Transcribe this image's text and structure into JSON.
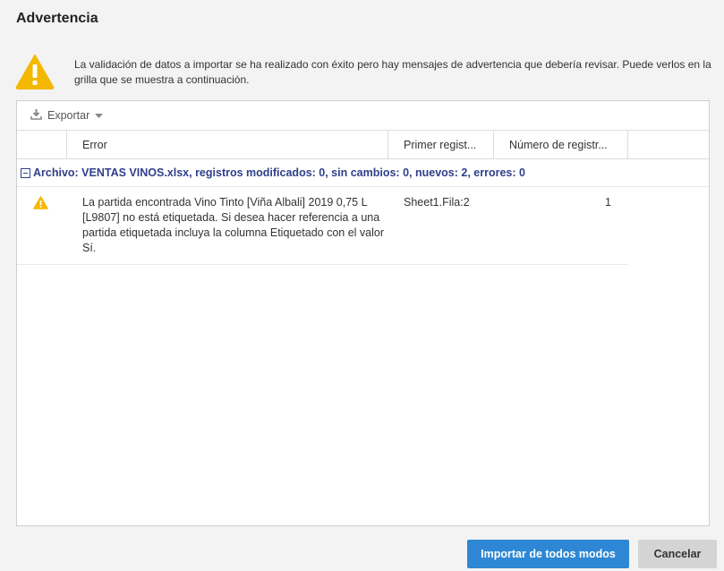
{
  "dialog": {
    "title": "Advertencia",
    "message": "La validación de datos a importar se ha realizado con éxito pero hay mensajes de advertencia que debería revisar. Puede verlos en la grilla que se muestra a continuación.",
    "warning_color": "#f5b800"
  },
  "toolbar": {
    "export_label": "Exportar",
    "export_icon": "download-icon",
    "dropdown_icon": "caret-down-icon"
  },
  "grid": {
    "columns": [
      "",
      "Error",
      "Primer regist...",
      "Número de registr..."
    ],
    "group_label": "Archivo: VENTAS VINOS.xlsx, registros modificados: 0, sin cambios: 0, nuevos: 2, errores: 0",
    "group_color": "#2f3f8a",
    "rows": [
      {
        "icon": "warning-icon",
        "error": "La partida encontrada Vino Tinto [Viña Albali] 2019 0,75 L [L9807] no está etiquetada. Si desea hacer referencia a una partida etiquetada incluya la columna Etiquetado con el valor Sí.",
        "primer": "Sheet1.Fila:2",
        "numero": "1"
      }
    ]
  },
  "buttons": {
    "import_label": "Importar de todos modos",
    "cancel_label": "Cancelar",
    "primary_color": "#2d87d4"
  }
}
